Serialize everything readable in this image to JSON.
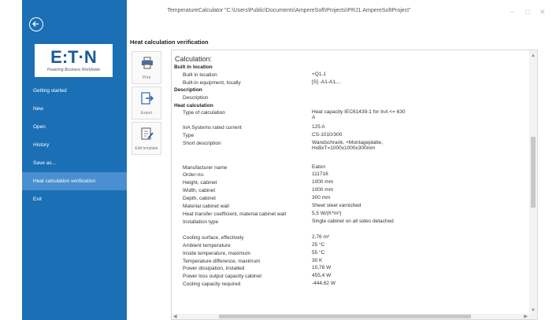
{
  "window": {
    "title": "TemperatureCalculator \"C:\\Users\\Public\\Documents\\AmpereSoft\\Projects\\PRJ1.AmpereSoftProject\"",
    "controls": [
      "–",
      "□",
      "✕"
    ]
  },
  "sidebar": {
    "logo": "E:T·N",
    "logo_tagline": "Powering Business Worldwide",
    "items": [
      {
        "label": "Getting started"
      },
      {
        "label": "New"
      },
      {
        "label": "Open"
      },
      {
        "label": "History"
      },
      {
        "label": "Save as..."
      },
      {
        "label": "Heat calculation verification",
        "active": true
      },
      {
        "label": "Exit"
      }
    ],
    "accent_color": "#1b6fb5",
    "active_color": "#4a8fd0"
  },
  "heading": "Heat calculation verification",
  "toolbar": {
    "print_label": "Print",
    "export_label": "Export",
    "edit_template_label": "Edit template"
  },
  "report": {
    "title": "Calculation:",
    "sections": [
      {
        "type": "section",
        "label": "Built in location"
      },
      {
        "type": "row",
        "label": "Built in location",
        "value": "+Q1.1"
      },
      {
        "type": "row",
        "label": "Built-in equipment, locally",
        "value": "[S] -A1-A1,..."
      },
      {
        "type": "section",
        "label": "Description"
      },
      {
        "type": "row",
        "label": "Description",
        "value": ""
      },
      {
        "type": "section",
        "label": "Heat calculation"
      },
      {
        "type": "row",
        "label": "Type of calculation",
        "value": "Heat capacity IEC61439-1 for InA <= 630 A"
      },
      {
        "type": "row",
        "label": "InA Systems rated current",
        "value": "125 A"
      },
      {
        "type": "row",
        "label": "Type",
        "value": "CS-1010/300"
      },
      {
        "type": "row",
        "label": "Short description",
        "value": "Wandschrank, +Montageplatte, HxBxT=1000x1000x300mm"
      },
      {
        "type": "row",
        "label": "Manufacturer name",
        "value": "Eaton"
      },
      {
        "type": "row",
        "label": "Order-no.",
        "value": "111716"
      },
      {
        "type": "row",
        "label": "Height, cabinet",
        "value": "1000 mm"
      },
      {
        "type": "row",
        "label": "Width, cabinet",
        "value": "1000 mm"
      },
      {
        "type": "row",
        "label": "Depth, cabinet",
        "value": "300 mm"
      },
      {
        "type": "row",
        "label": "Material cabinet wall",
        "value": "Sheet steel varnished"
      },
      {
        "type": "row",
        "label": "Heat transfer coefficient, material cabinet wall",
        "value": "5,5 W/(K*m²)"
      },
      {
        "type": "row",
        "label": "Installation type",
        "value": "Single cabinet on all sides detached"
      },
      {
        "type": "row",
        "label": "Cooling surface, effectively",
        "value": "2,76 m²"
      },
      {
        "type": "row",
        "label": "Ambient temperature",
        "value": "25 °C"
      },
      {
        "type": "row",
        "label": "Inside temperature, maximum",
        "value": "55 °C"
      },
      {
        "type": "row",
        "label": "Temperature difference, maximum",
        "value": "30 K"
      },
      {
        "type": "row",
        "label": "Power dissipation, installed",
        "value": "10,78 W"
      },
      {
        "type": "row",
        "label": "Power loss output capacity cabinet",
        "value": "455,4 W"
      },
      {
        "type": "row",
        "label": "Cooling capacity required",
        "value": "-444,62 W"
      }
    ]
  }
}
